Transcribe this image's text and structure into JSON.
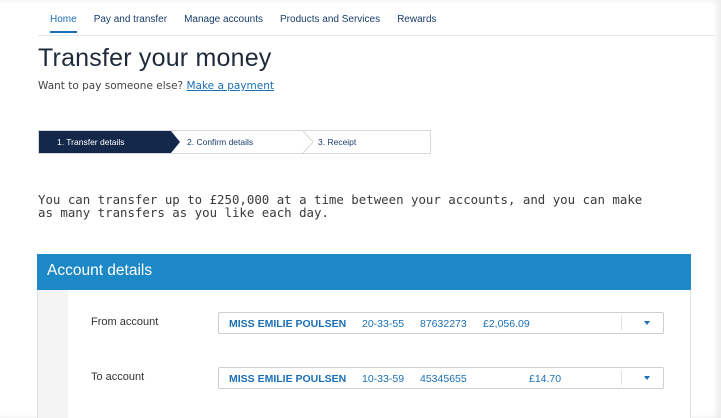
{
  "nav": {
    "items": [
      {
        "label": "Home",
        "active": true
      },
      {
        "label": "Pay and transfer",
        "active": false
      },
      {
        "label": "Manage accounts",
        "active": false
      },
      {
        "label": "Products and Services",
        "active": false
      },
      {
        "label": "Rewards",
        "active": false
      }
    ]
  },
  "header": {
    "title": "Transfer your money",
    "subtitle_prefix": "Want to pay someone else?",
    "subtitle_link": "Make a payment"
  },
  "stepper": {
    "steps": [
      {
        "label": "1. Transfer details",
        "active": true
      },
      {
        "label": "2. Confirm details",
        "active": false
      },
      {
        "label": "3. Receipt",
        "active": false
      }
    ]
  },
  "info_text": "You can transfer up to £250,000 at a time between your accounts, and you can make as many transfers as you like each day.",
  "panel": {
    "title": "Account details",
    "from": {
      "label": "From account",
      "name": "MISS EMILIE POULSEN",
      "sort_code": "20-33-55",
      "account_number": "87632273",
      "balance": "£2,056.09"
    },
    "to": {
      "label": "To account",
      "name": "MISS EMILIE POULSEN",
      "sort_code": "10-33-59",
      "account_number": "45345655",
      "balance": "£14.70"
    }
  },
  "colors": {
    "brand_blue": "#1c88c6",
    "link_blue": "#1a6fb5",
    "navy": "#13284a"
  }
}
